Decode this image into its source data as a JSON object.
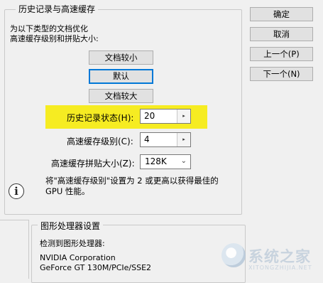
{
  "history_cache": {
    "legend": "历史记录与高速缓存",
    "description_line1": "为以下类型的文档优化",
    "description_line2": "高速缓存级别和拼贴大小:",
    "buttons": {
      "small_docs": "文档较小",
      "default": "默认",
      "large_docs": "文档较大"
    },
    "history_states": {
      "label": "历史记录状态(H):",
      "value": "20"
    },
    "cache_levels": {
      "label": "高速缓存级别(C):",
      "value": "4"
    },
    "cache_tile_size": {
      "label": "高速缓存拼贴大小(Z):",
      "value": "128K"
    },
    "info_line1": "将\"高速缓存级别\"设置为 2 或更高以获得最佳的",
    "info_line2": "GPU 性能。"
  },
  "dialog_buttons": {
    "ok": "确定",
    "cancel": "取消",
    "prev": "上一个(P)",
    "next": "下一个(N)"
  },
  "gpu": {
    "legend": "图形处理器设置",
    "detected_label": "检测到图形处理器:",
    "vendor": "NVIDIA Corporation",
    "model": "GeForce GT 130M/PCIe/SSE2"
  },
  "icons": {
    "spin_arrow": "▸",
    "dropdown": "⌄",
    "info": "i"
  },
  "watermark": {
    "name": "系统之家",
    "url": "XITONGZHIJIA.NET"
  }
}
